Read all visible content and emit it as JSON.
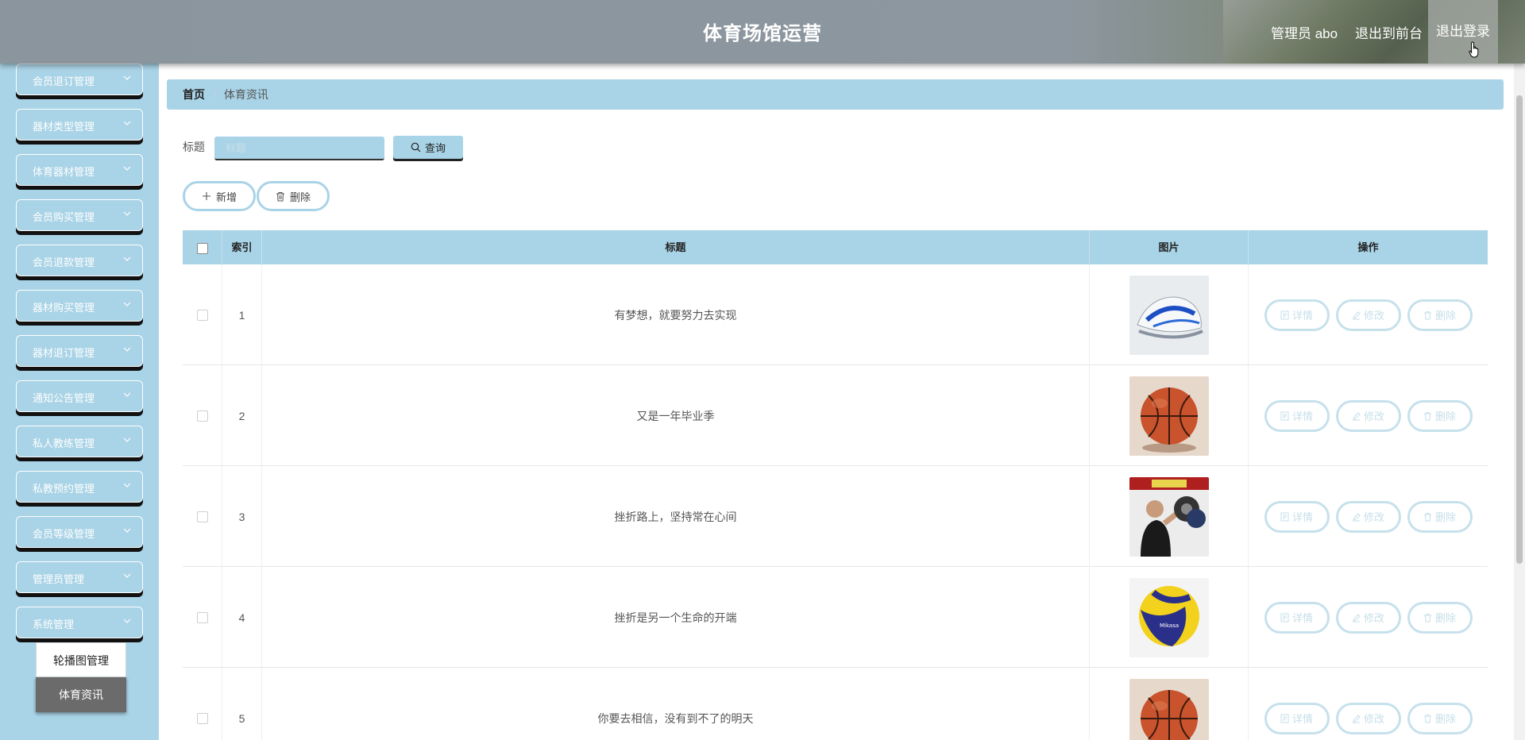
{
  "header": {
    "title": "体育场馆运营",
    "user": "管理员 abo",
    "to_front": "退出到前台",
    "logout": "退出登录"
  },
  "sidebar": {
    "items": [
      {
        "label": "会员退订管理"
      },
      {
        "label": "器材类型管理"
      },
      {
        "label": "体育器材管理"
      },
      {
        "label": "会员购买管理"
      },
      {
        "label": "会员退款管理"
      },
      {
        "label": "器材购买管理"
      },
      {
        "label": "器材退订管理"
      },
      {
        "label": "通知公告管理"
      },
      {
        "label": "私人教练管理"
      },
      {
        "label": "私教预约管理"
      },
      {
        "label": "会员等级管理"
      },
      {
        "label": "管理员管理"
      },
      {
        "label": "系统管理"
      }
    ],
    "submenu": [
      "轮播图管理",
      "体育资讯"
    ]
  },
  "breadcrumb": {
    "home": "首页",
    "separator": "/",
    "current": "体育资讯"
  },
  "search": {
    "label": "标题",
    "placeholder": "标题",
    "button": "查询"
  },
  "toolbar": {
    "add": "新增",
    "delete": "删除"
  },
  "table": {
    "headers": {
      "index": "索引",
      "title": "标题",
      "image": "图片",
      "actions": "操作"
    },
    "actions": {
      "detail": "详情",
      "edit": "修改",
      "delete": "删除"
    },
    "rows": [
      {
        "index": "1",
        "title": "有梦想，就要努力去实现",
        "image": "sneaker"
      },
      {
        "index": "2",
        "title": "又是一年毕业季",
        "image": "basketball"
      },
      {
        "index": "3",
        "title": "挫折路上，坚持常在心间",
        "image": "fitness-man"
      },
      {
        "index": "4",
        "title": "挫折是另一个生命的开端",
        "image": "volleyball"
      },
      {
        "index": "5",
        "title": "你要去相信，没有到不了的明天",
        "image": "basketball"
      }
    ]
  },
  "colors": {
    "accent": "#a9d3e6",
    "header": "#8d979f"
  }
}
